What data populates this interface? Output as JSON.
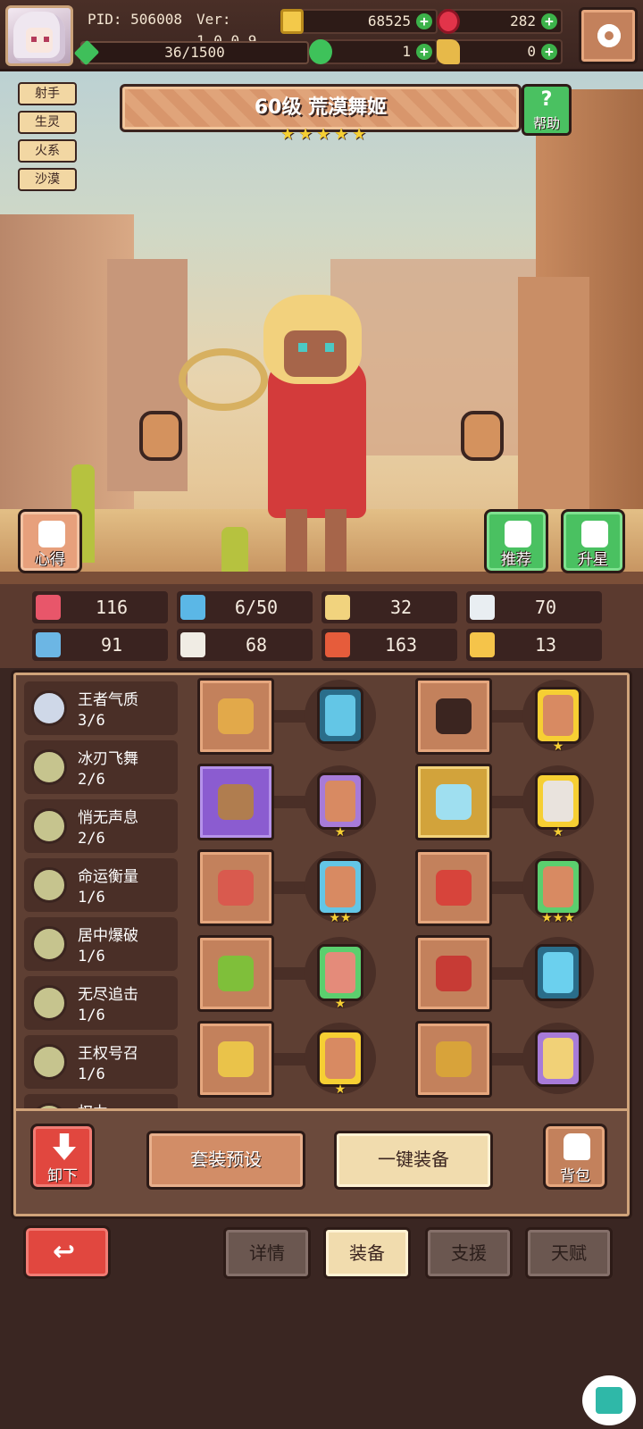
{
  "header": {
    "pid": "PID: 506008",
    "version": "Ver: 1.0.0.9",
    "gold": "68525",
    "ruby": "282",
    "exp": "36/1500",
    "exp_progress": 0.024,
    "clover": "1",
    "key": "0",
    "icons": {
      "gold": "coin-icon",
      "ruby": "ruby-icon",
      "clover": "clover-icon",
      "key": "key-icon",
      "settings": "gear-icon"
    }
  },
  "hero": {
    "level_name": "60级 荒漠舞姬",
    "stars": 5,
    "star_glyph": "★",
    "tags": [
      "射手",
      "生灵",
      "火系",
      "沙漠"
    ],
    "help_label": "帮助",
    "help_glyph": "?"
  },
  "scene_buttons": {
    "xinde": "心得",
    "tuijian": "推荐",
    "shengxing": "升星"
  },
  "stats": [
    {
      "icon": "heart-icon",
      "value": "116",
      "color": "#e8566a"
    },
    {
      "icon": "water-drop-icon",
      "value": "6/50",
      "color": "#5bb7e6"
    },
    {
      "icon": "shield-icon",
      "value": "32",
      "color": "#f1d37e"
    },
    {
      "icon": "wing-icon",
      "value": "70",
      "color": "#e9eef2"
    },
    {
      "icon": "fist-icon",
      "value": "91",
      "color": "#6cb6e4"
    },
    {
      "icon": "book-icon",
      "value": "68",
      "color": "#f0ece4"
    },
    {
      "icon": "potion-icon",
      "value": "163",
      "color": "#e65c3b"
    },
    {
      "icon": "horseshoe-icon",
      "value": "13",
      "color": "#f5c44a"
    }
  ],
  "skills": [
    {
      "name": "王者气质",
      "level": "3/6",
      "color": "#cfd8e8"
    },
    {
      "name": "冰刃飞舞",
      "level": "2/6",
      "color": "#c6c48e"
    },
    {
      "name": "悄无声息",
      "level": "2/6",
      "color": "#c6c48e"
    },
    {
      "name": "命运衡量",
      "level": "1/6",
      "color": "#c6c48e"
    },
    {
      "name": "居中爆破",
      "level": "1/6",
      "color": "#c6c48e"
    },
    {
      "name": "无尽追击",
      "level": "1/6",
      "color": "#c6c48e"
    },
    {
      "name": "王权号召",
      "level": "1/6",
      "color": "#c6c48e"
    },
    {
      "name": "权力",
      "level": "",
      "color": "#c6c48e"
    }
  ],
  "equipment": [
    {
      "slot": "weapon-scepter-icon",
      "rarity": "normal",
      "item_color": "#e2a94a",
      "rune_color": "#63c6e6",
      "rune_border": "#2a6d8a",
      "rune_stars": 0
    },
    {
      "slot": "helmet-cat-icon",
      "rarity": "normal",
      "item_color": "#3b2520",
      "rune_color": "#d88a62",
      "rune_border": "#f6cf33",
      "rune_stars": 1
    },
    {
      "slot": "potato-icon",
      "rarity": "purple",
      "item_color": "#b07d4f",
      "rune_color": "#d88a62",
      "rune_border": "#a77bd8",
      "rune_stars": 1
    },
    {
      "slot": "armor-ice-icon",
      "rarity": "gold",
      "item_color": "#9fdff0",
      "rune_color": "#e9e3dd",
      "rune_border": "#f6cf33",
      "rune_stars": 1
    },
    {
      "slot": "collar-icon",
      "rarity": "normal",
      "item_color": "#d95a4e",
      "rune_color": "#d88a62",
      "rune_border": "#63c6e6",
      "rune_stars": 2
    },
    {
      "slot": "glove-icon",
      "rarity": "normal",
      "item_color": "#d7443b",
      "rune_color": "#d88a62",
      "rune_border": "#5bcf6e",
      "rune_stars": 3
    },
    {
      "slot": "crown-leaf-icon",
      "rarity": "normal",
      "item_color": "#7fbf3a",
      "rune_color": "#e48b7a",
      "rune_border": "#5bcf6e",
      "rune_stars": 1
    },
    {
      "slot": "amulet-icon",
      "rarity": "normal",
      "item_color": "#c73b35",
      "rune_color": "#6bd0ee",
      "rune_border": "#2a6d8a",
      "rune_stars": 0
    },
    {
      "slot": "ring-icon",
      "rarity": "normal",
      "item_color": "#eac34a",
      "rune_color": "#d88a62",
      "rune_border": "#f6cf33",
      "rune_stars": 1
    },
    {
      "slot": "boots-icon",
      "rarity": "normal",
      "item_color": "#d8a33a",
      "rune_color": "#f1d177",
      "rune_border": "#a77bd8",
      "rune_stars": 0
    }
  ],
  "equipment_stars_extra": [
    {
      "index": 9,
      "note": "boots slot"
    }
  ],
  "actions": {
    "unload": "卸下",
    "preset": "套装预设",
    "one_click": "一键装备",
    "bag": "背包"
  },
  "nav": {
    "back_glyph": "↩",
    "tabs": [
      {
        "label": "详情",
        "active": false
      },
      {
        "label": "装备",
        "active": true
      },
      {
        "label": "支援",
        "active": false
      },
      {
        "label": "天赋",
        "active": false
      }
    ]
  },
  "colors": {
    "panel_bg": "#5e3f33",
    "accent_green": "#4ac161",
    "accent_red": "#e1473f",
    "cream": "#f1dcae"
  }
}
